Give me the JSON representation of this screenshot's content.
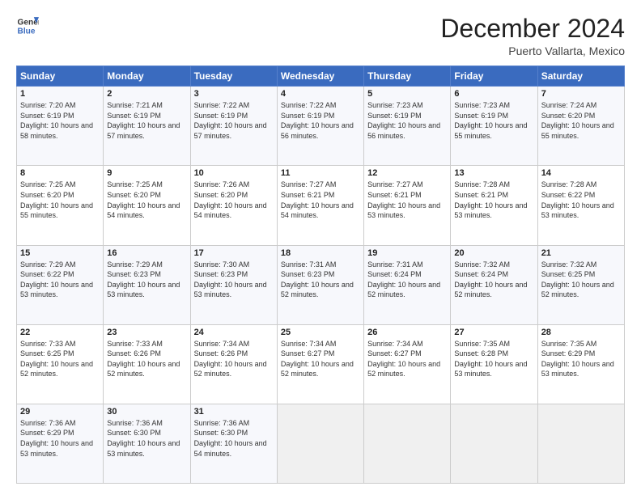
{
  "logo": {
    "line1": "General",
    "line2": "Blue"
  },
  "title": "December 2024",
  "subtitle": "Puerto Vallarta, Mexico",
  "days_header": [
    "Sunday",
    "Monday",
    "Tuesday",
    "Wednesday",
    "Thursday",
    "Friday",
    "Saturday"
  ],
  "weeks": [
    [
      {
        "day": "1",
        "sunrise": "Sunrise: 7:20 AM",
        "sunset": "Sunset: 6:19 PM",
        "daylight": "Daylight: 10 hours and 58 minutes."
      },
      {
        "day": "2",
        "sunrise": "Sunrise: 7:21 AM",
        "sunset": "Sunset: 6:19 PM",
        "daylight": "Daylight: 10 hours and 57 minutes."
      },
      {
        "day": "3",
        "sunrise": "Sunrise: 7:22 AM",
        "sunset": "Sunset: 6:19 PM",
        "daylight": "Daylight: 10 hours and 57 minutes."
      },
      {
        "day": "4",
        "sunrise": "Sunrise: 7:22 AM",
        "sunset": "Sunset: 6:19 PM",
        "daylight": "Daylight: 10 hours and 56 minutes."
      },
      {
        "day": "5",
        "sunrise": "Sunrise: 7:23 AM",
        "sunset": "Sunset: 6:19 PM",
        "daylight": "Daylight: 10 hours and 56 minutes."
      },
      {
        "day": "6",
        "sunrise": "Sunrise: 7:23 AM",
        "sunset": "Sunset: 6:19 PM",
        "daylight": "Daylight: 10 hours and 55 minutes."
      },
      {
        "day": "7",
        "sunrise": "Sunrise: 7:24 AM",
        "sunset": "Sunset: 6:20 PM",
        "daylight": "Daylight: 10 hours and 55 minutes."
      }
    ],
    [
      {
        "day": "8",
        "sunrise": "Sunrise: 7:25 AM",
        "sunset": "Sunset: 6:20 PM",
        "daylight": "Daylight: 10 hours and 55 minutes."
      },
      {
        "day": "9",
        "sunrise": "Sunrise: 7:25 AM",
        "sunset": "Sunset: 6:20 PM",
        "daylight": "Daylight: 10 hours and 54 minutes."
      },
      {
        "day": "10",
        "sunrise": "Sunrise: 7:26 AM",
        "sunset": "Sunset: 6:20 PM",
        "daylight": "Daylight: 10 hours and 54 minutes."
      },
      {
        "day": "11",
        "sunrise": "Sunrise: 7:27 AM",
        "sunset": "Sunset: 6:21 PM",
        "daylight": "Daylight: 10 hours and 54 minutes."
      },
      {
        "day": "12",
        "sunrise": "Sunrise: 7:27 AM",
        "sunset": "Sunset: 6:21 PM",
        "daylight": "Daylight: 10 hours and 53 minutes."
      },
      {
        "day": "13",
        "sunrise": "Sunrise: 7:28 AM",
        "sunset": "Sunset: 6:21 PM",
        "daylight": "Daylight: 10 hours and 53 minutes."
      },
      {
        "day": "14",
        "sunrise": "Sunrise: 7:28 AM",
        "sunset": "Sunset: 6:22 PM",
        "daylight": "Daylight: 10 hours and 53 minutes."
      }
    ],
    [
      {
        "day": "15",
        "sunrise": "Sunrise: 7:29 AM",
        "sunset": "Sunset: 6:22 PM",
        "daylight": "Daylight: 10 hours and 53 minutes."
      },
      {
        "day": "16",
        "sunrise": "Sunrise: 7:29 AM",
        "sunset": "Sunset: 6:23 PM",
        "daylight": "Daylight: 10 hours and 53 minutes."
      },
      {
        "day": "17",
        "sunrise": "Sunrise: 7:30 AM",
        "sunset": "Sunset: 6:23 PM",
        "daylight": "Daylight: 10 hours and 53 minutes."
      },
      {
        "day": "18",
        "sunrise": "Sunrise: 7:31 AM",
        "sunset": "Sunset: 6:23 PM",
        "daylight": "Daylight: 10 hours and 52 minutes."
      },
      {
        "day": "19",
        "sunrise": "Sunrise: 7:31 AM",
        "sunset": "Sunset: 6:24 PM",
        "daylight": "Daylight: 10 hours and 52 minutes."
      },
      {
        "day": "20",
        "sunrise": "Sunrise: 7:32 AM",
        "sunset": "Sunset: 6:24 PM",
        "daylight": "Daylight: 10 hours and 52 minutes."
      },
      {
        "day": "21",
        "sunrise": "Sunrise: 7:32 AM",
        "sunset": "Sunset: 6:25 PM",
        "daylight": "Daylight: 10 hours and 52 minutes."
      }
    ],
    [
      {
        "day": "22",
        "sunrise": "Sunrise: 7:33 AM",
        "sunset": "Sunset: 6:25 PM",
        "daylight": "Daylight: 10 hours and 52 minutes."
      },
      {
        "day": "23",
        "sunrise": "Sunrise: 7:33 AM",
        "sunset": "Sunset: 6:26 PM",
        "daylight": "Daylight: 10 hours and 52 minutes."
      },
      {
        "day": "24",
        "sunrise": "Sunrise: 7:34 AM",
        "sunset": "Sunset: 6:26 PM",
        "daylight": "Daylight: 10 hours and 52 minutes."
      },
      {
        "day": "25",
        "sunrise": "Sunrise: 7:34 AM",
        "sunset": "Sunset: 6:27 PM",
        "daylight": "Daylight: 10 hours and 52 minutes."
      },
      {
        "day": "26",
        "sunrise": "Sunrise: 7:34 AM",
        "sunset": "Sunset: 6:27 PM",
        "daylight": "Daylight: 10 hours and 52 minutes."
      },
      {
        "day": "27",
        "sunrise": "Sunrise: 7:35 AM",
        "sunset": "Sunset: 6:28 PM",
        "daylight": "Daylight: 10 hours and 53 minutes."
      },
      {
        "day": "28",
        "sunrise": "Sunrise: 7:35 AM",
        "sunset": "Sunset: 6:29 PM",
        "daylight": "Daylight: 10 hours and 53 minutes."
      }
    ],
    [
      {
        "day": "29",
        "sunrise": "Sunrise: 7:36 AM",
        "sunset": "Sunset: 6:29 PM",
        "daylight": "Daylight: 10 hours and 53 minutes."
      },
      {
        "day": "30",
        "sunrise": "Sunrise: 7:36 AM",
        "sunset": "Sunset: 6:30 PM",
        "daylight": "Daylight: 10 hours and 53 minutes."
      },
      {
        "day": "31",
        "sunrise": "Sunrise: 7:36 AM",
        "sunset": "Sunset: 6:30 PM",
        "daylight": "Daylight: 10 hours and 54 minutes."
      },
      null,
      null,
      null,
      null
    ]
  ]
}
